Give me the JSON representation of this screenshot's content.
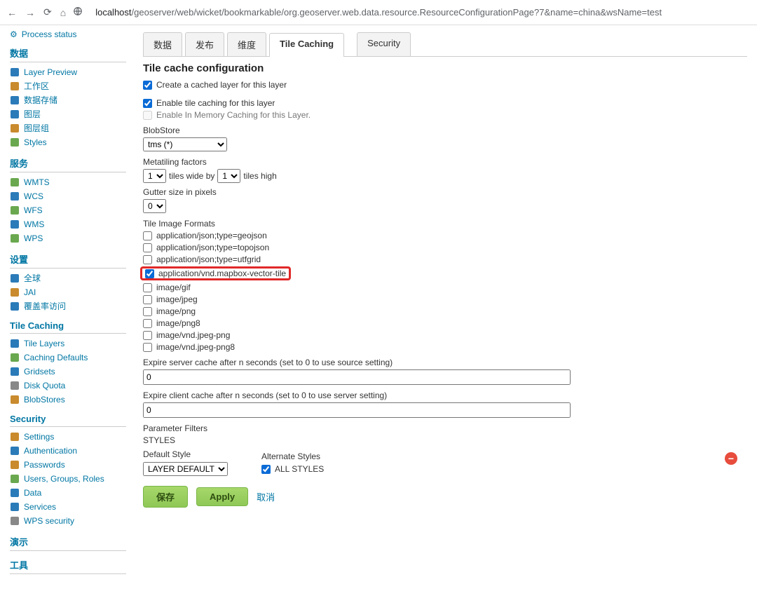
{
  "browser": {
    "url_prefix": "localhost",
    "url_rest": "/geoserver/web/wicket/bookmarkable/org.geoserver.web.data.resource.ResourceConfigurationPage?7&name=china&wsName=test"
  },
  "sidebar": {
    "process_status": "Process status",
    "groups": [
      {
        "title": "数据",
        "items": [
          "Layer Preview",
          "工作区",
          "数据存储",
          "图层",
          "图层组",
          "Styles"
        ]
      },
      {
        "title": "服务",
        "items": [
          "WMTS",
          "WCS",
          "WFS",
          "WMS",
          "WPS"
        ]
      },
      {
        "title": "设置",
        "items": [
          "全球",
          "JAI",
          "覆盖率访问"
        ]
      },
      {
        "title": "Tile Caching",
        "items": [
          "Tile Layers",
          "Caching Defaults",
          "Gridsets",
          "Disk Quota",
          "BlobStores"
        ]
      },
      {
        "title": "Security",
        "items": [
          "Settings",
          "Authentication",
          "Passwords",
          "Users, Groups, Roles",
          "Data",
          "Services",
          "WPS security"
        ]
      },
      {
        "title": "演示",
        "items": []
      },
      {
        "title": "工具",
        "items": []
      }
    ]
  },
  "tabs": {
    "items": [
      "数据",
      "发布",
      "维度",
      "Tile Caching",
      "Security"
    ],
    "active": 3
  },
  "page": {
    "title": "Tile cache configuration",
    "create_cached": {
      "label": "Create a cached layer for this layer",
      "checked": true
    },
    "enable_tile": {
      "label": "Enable tile caching for this layer",
      "checked": true
    },
    "enable_mem": {
      "label": "Enable In Memory Caching for this Layer.",
      "checked": false,
      "disabled": true
    },
    "blobstore_label": "BlobStore",
    "blobstore_value": "tms (*)",
    "meta_label": "Metatiling factors",
    "meta_wide": "1",
    "meta_mid": "tiles wide by",
    "meta_high": "1",
    "meta_end": "tiles high",
    "gutter_label": "Gutter size in pixels",
    "gutter_value": "0",
    "formats_label": "Tile Image Formats",
    "formats": [
      {
        "name": "application/json;type=geojson",
        "checked": false
      },
      {
        "name": "application/json;type=topojson",
        "checked": false
      },
      {
        "name": "application/json;type=utfgrid",
        "checked": false
      },
      {
        "name": "application/vnd.mapbox-vector-tile",
        "checked": true,
        "highlight": true
      },
      {
        "name": "image/gif",
        "checked": false
      },
      {
        "name": "image/jpeg",
        "checked": false
      },
      {
        "name": "image/png",
        "checked": false
      },
      {
        "name": "image/png8",
        "checked": false
      },
      {
        "name": "image/vnd.jpeg-png",
        "checked": false
      },
      {
        "name": "image/vnd.jpeg-png8",
        "checked": false
      }
    ],
    "expire_server_label": "Expire server cache after n seconds (set to 0 to use source setting)",
    "expire_server_value": "0",
    "expire_client_label": "Expire client cache after n seconds (set to 0 to use server setting)",
    "expire_client_value": "0",
    "param_filters": "Parameter Filters",
    "styles": "STYLES",
    "default_style": "Default Style",
    "default_style_value": "LAYER DEFAULT",
    "alt_styles": "Alternate Styles",
    "all_styles": "ALL STYLES",
    "btn_save": "保存",
    "btn_apply": "Apply",
    "btn_cancel": "取消"
  }
}
